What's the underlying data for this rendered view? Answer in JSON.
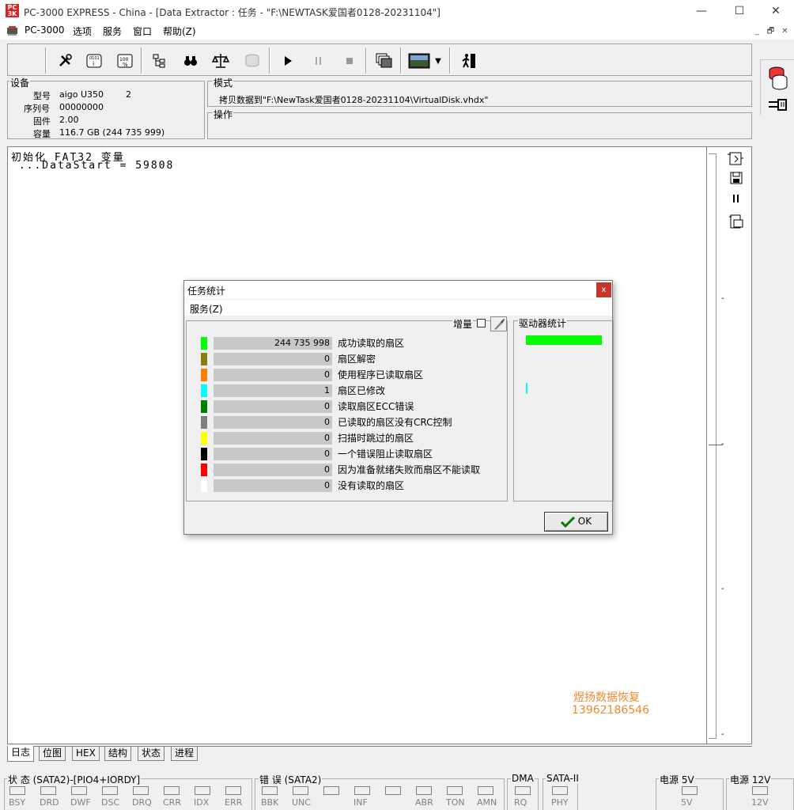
{
  "window": {
    "title": "PC-3000 EXPRESS - China - [Data Extractor : 任务 - \"F:\\NEWTASK爱国者0128-20231104\"]",
    "logo_text": "PC 3K",
    "minimize": "—",
    "maximize": "☐",
    "close": "✕"
  },
  "menu": {
    "items": [
      "PC-3000",
      "选项",
      "服务",
      "窗口",
      "帮助(Z)"
    ],
    "mdi_min": "_",
    "mdi_restore": "🗗",
    "mdi_close": "✕"
  },
  "device": {
    "group_title": "设备",
    "model_label": "型号",
    "model_value": "aigo U350",
    "model_extra": "2",
    "serial_label": "序列号",
    "serial_value": "00000000",
    "firmware_label": "固件",
    "firmware_value": "2.00",
    "capacity_label": "容量",
    "capacity_value": "116.7 GB (244 735 999)"
  },
  "mode": {
    "group_title": "模式",
    "text": "拷贝数据到\"F:\\NewTask爱国者0128-20231104\\VirtualDisk.vhdx\""
  },
  "operation": {
    "group_title": "操作"
  },
  "log": {
    "lines": [
      "初始化 FAT32 变量",
      " ...DataStart = 59808"
    ]
  },
  "watermark": {
    "line1": "煜扬数据恢复",
    "line2": "13962186546"
  },
  "tabs": [
    "日志",
    "位图",
    "HEX",
    "结构",
    "状态",
    "进程"
  ],
  "status": {
    "state_title": "状 态 (SATA2)-[PIO4+IORDY]",
    "state_leds": [
      "BSY",
      "DRD",
      "DWF",
      "DSC",
      "DRQ",
      "CRR",
      "IDX",
      "ERR"
    ],
    "error_title": "错 误 (SATA2)",
    "error_leds": [
      "BBK",
      "UNC",
      "",
      "INF",
      "",
      "ABR",
      "TON",
      "AMN"
    ],
    "dma_title": "DMA",
    "dma_leds": [
      "RQ"
    ],
    "sata_title": "SATA-II",
    "sata_leds": [
      "PHY"
    ],
    "power5_title": "电源 5V",
    "power5_leds": [
      "5V"
    ],
    "power12_title": "电源 12V",
    "power12_leds": [
      "12V"
    ]
  },
  "dialog": {
    "title": "任务统计",
    "close": "x",
    "menu": "服务(Z)",
    "increment_label": "增量",
    "drive_stats_title": "驱动器统计",
    "ok": "OK",
    "rows": [
      {
        "color": "#00ff00",
        "value": "244 735 998",
        "label": "成功读取的扇区"
      },
      {
        "color": "#8b7b10",
        "value": "0",
        "label": "扇区解密"
      },
      {
        "color": "#ff8000",
        "value": "0",
        "label": "使用程序已读取扇区"
      },
      {
        "color": "#00ffff",
        "value": "1",
        "label": "扇区已修改"
      },
      {
        "color": "#008000",
        "value": "0",
        "label": "读取扇区ECC错误"
      },
      {
        "color": "#808080",
        "value": "0",
        "label": "已读取的扇区没有CRC控制"
      },
      {
        "color": "#ffff00",
        "value": "0",
        "label": "扫描时跳过的扇区"
      },
      {
        "color": "#000000",
        "value": "0",
        "label": "一个错误阻止读取扇区"
      },
      {
        "color": "#ff0000",
        "value": "0",
        "label": "因为准备就绪失败而扇区不能读取"
      },
      {
        "color": "#ffffff",
        "value": "0",
        "label": "没有读取的扇区"
      }
    ],
    "drive_bars": [
      {
        "color": "#00ff00",
        "fraction": 1.0
      },
      {
        "color": "#00ffff",
        "fraction": 0.02
      }
    ]
  },
  "toolbar": {
    "icons": [
      "tools-icon",
      "drive-info-icon",
      "percent-icon",
      "tree-icon",
      "binoculars-icon",
      "scales-icon",
      "disk-disabled-icon",
      "play-icon",
      "pause-icon",
      "stop-icon",
      "windows-icon",
      "screen-icon",
      "dropdown-icon",
      "exit-icon"
    ]
  }
}
